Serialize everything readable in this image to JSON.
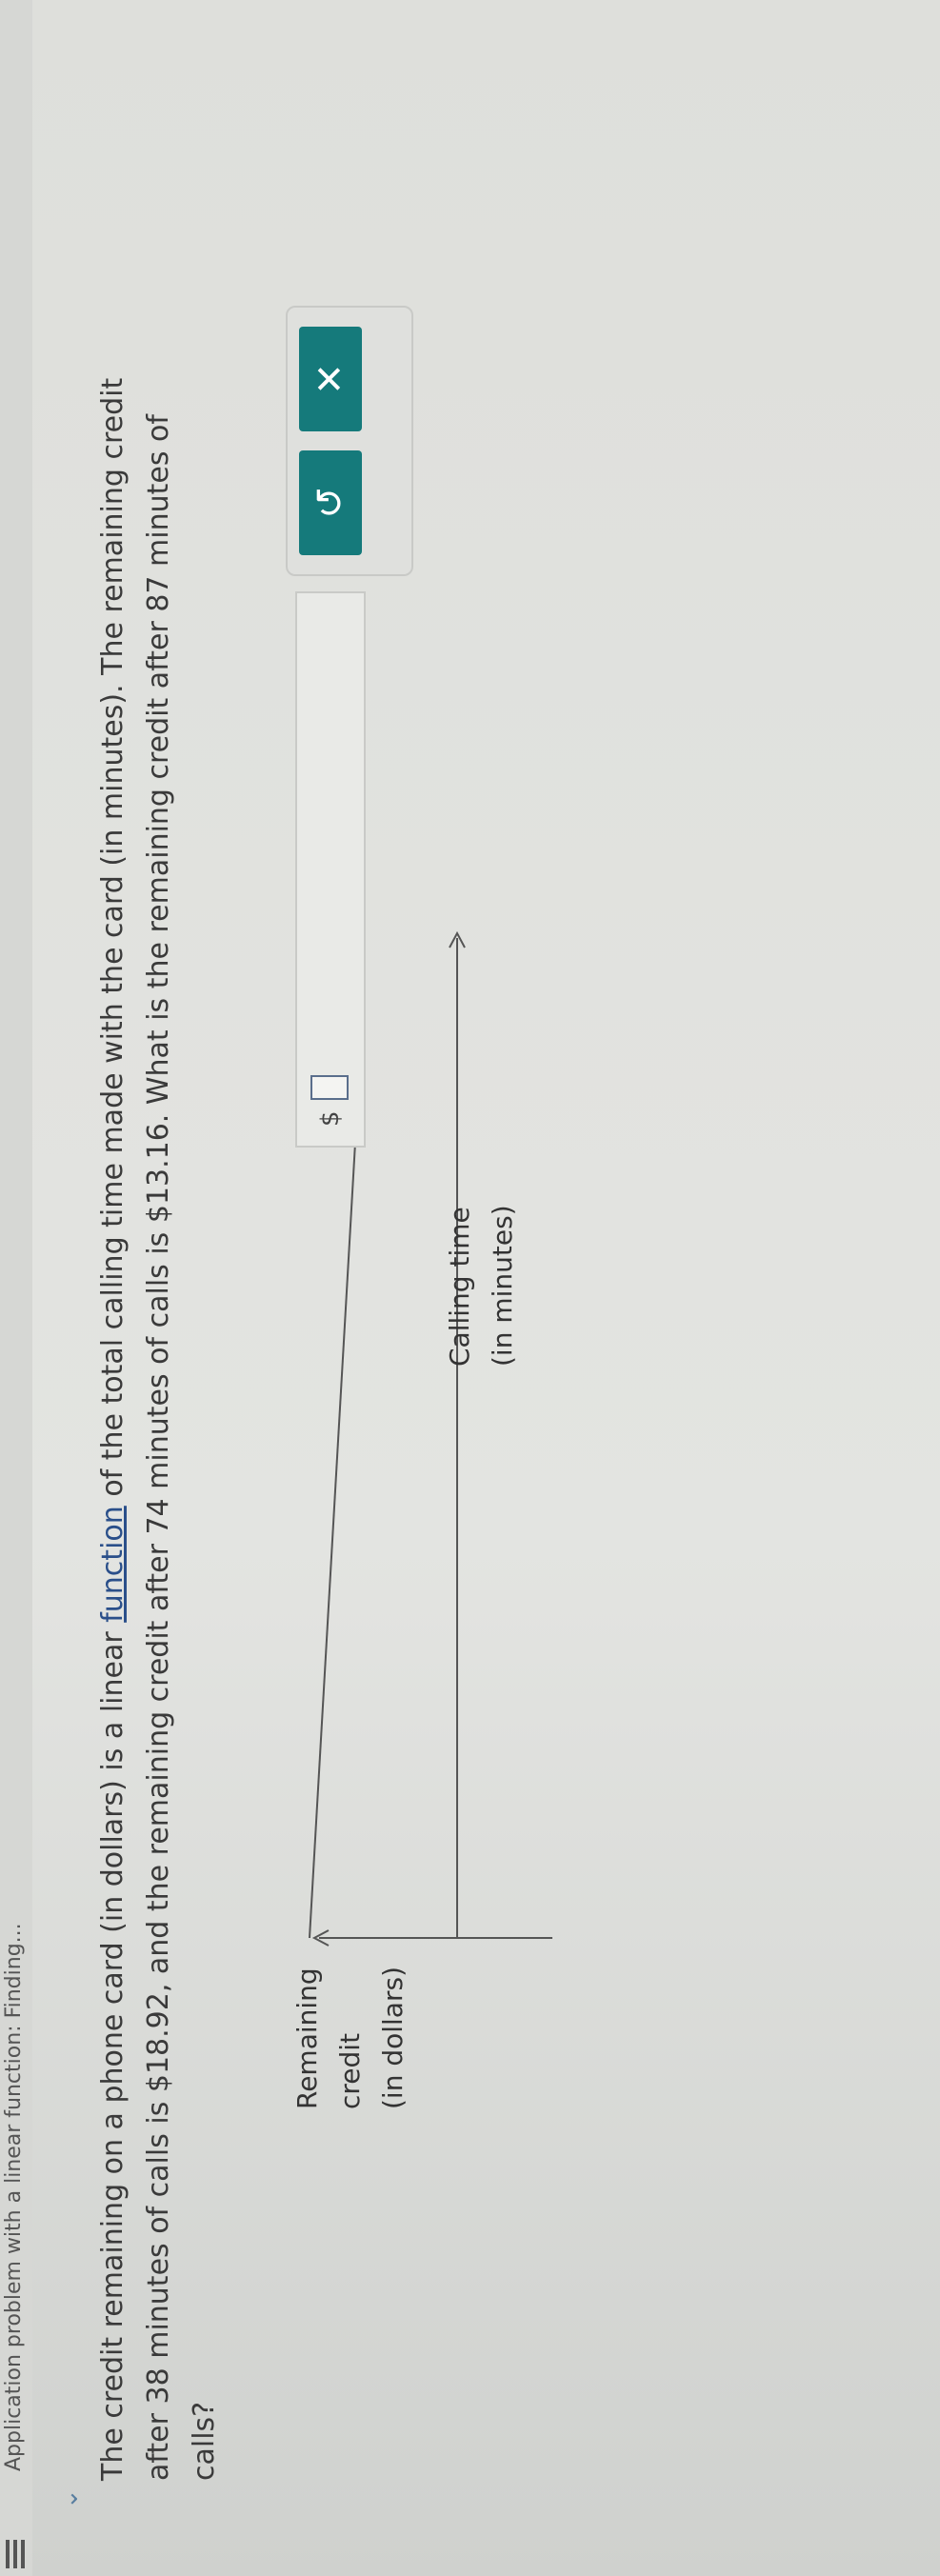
{
  "header": {
    "title": "Application problem with a linear function: Finding..."
  },
  "problem": {
    "line1_before_link": "The credit remaining on a phone card (in dollars) is a linear ",
    "link_text": "function",
    "line1_after_link": " of the total calling time made with the card (in minutes). The remaining credit",
    "line2": "after 38 minutes of calls is $18.92, and the remaining credit after 74 minutes of calls is $13.16. What is the remaining credit after 87 minutes of",
    "line3": "calls?"
  },
  "graph": {
    "y_axis_label_1": "Remaining",
    "y_axis_label_2": "credit",
    "y_axis_label_3": "(in dollars)",
    "x_axis_label_1": "Calling time",
    "x_axis_label_2": "(in minutes)"
  },
  "answer": {
    "prefix": "$",
    "value": ""
  },
  "buttons": {
    "undo_label": "↺",
    "clear_label": "✕"
  },
  "colors": {
    "accent": "#157a7b",
    "link": "#2a4f8a"
  }
}
